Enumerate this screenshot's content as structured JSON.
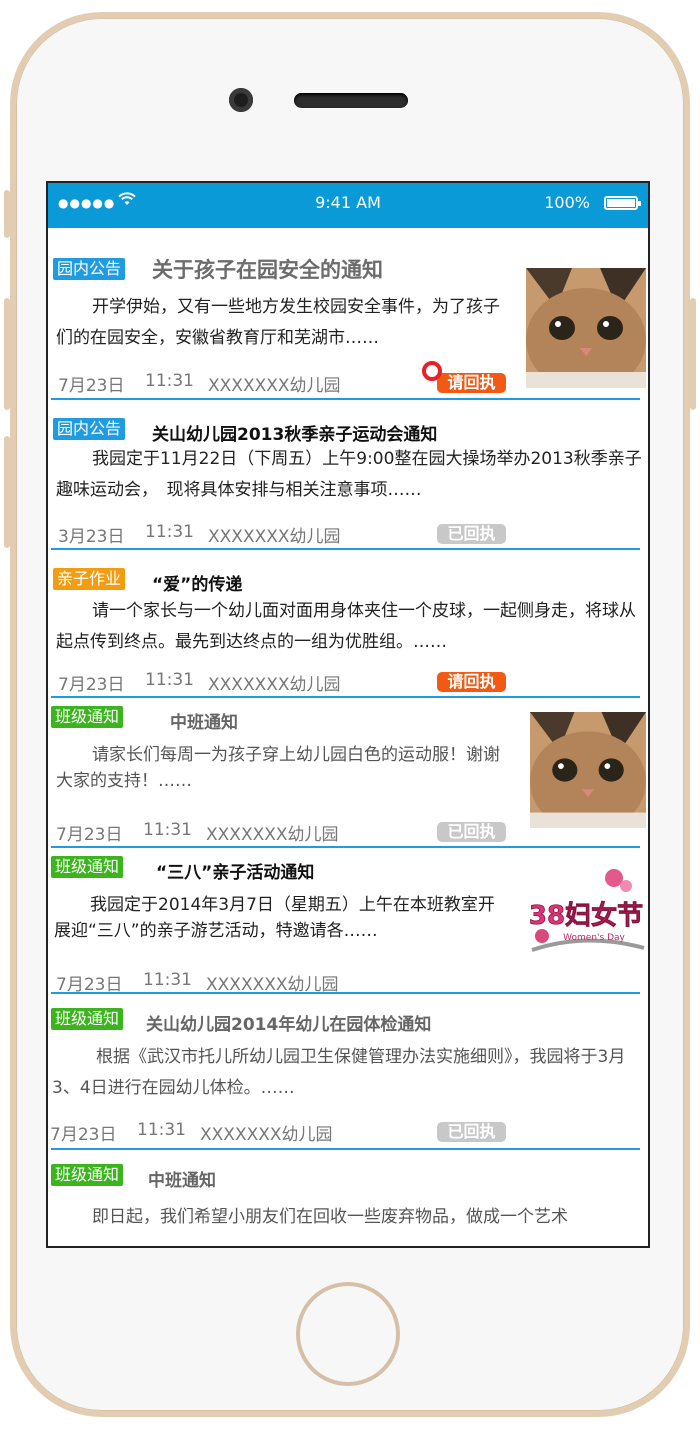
{
  "status_bar": {
    "signal": "●●●●●",
    "time": "9:41 AM",
    "battery": "100%"
  },
  "notices": [
    {
      "tag": "园内公告",
      "title": "关于孩子在园安全的通知",
      "body": "开学伊始，又有一些地方发生校园安全事件，为了孩子们的在园安全，安徽省教育厅和芜湖市……",
      "date": "7月23日",
      "time": "11:31",
      "school": "XXXXXXX幼儿园",
      "receipt": "请回执",
      "thumbnail": "cat-photo"
    },
    {
      "tag": "园内公告",
      "title": "关山幼儿园2013秋季亲子运动会通知",
      "body": "我园定于11月22日（下周五）上午9:00整在园大操场举办2013秋季亲子趣味运动会，　现将具体安排与相关注意事项……",
      "date": "3月23日",
      "time": "11:31",
      "school": "XXXXXXX幼儿园",
      "receipt": "已回执"
    },
    {
      "tag": "亲子作业",
      "title": "“爱”的传递",
      "body": "请一个家长与一个幼儿面对面用身体夹住一个皮球，一起侧身走，将球从起点传到终点。最先到达终点的一组为优胜组。……",
      "date": "7月23日",
      "time": "11:31",
      "school": "XXXXXXX幼儿园",
      "receipt": "请回执"
    },
    {
      "tag": "班级通知",
      "title": "中班通知",
      "body": "请家长们每周一为孩子穿上幼儿园白色的运动服！谢谢大家的支持！……",
      "date": "7月23日",
      "time": "11:31",
      "school": "XXXXXXX幼儿园",
      "receipt": "已回执",
      "thumbnail": "cat-photo"
    },
    {
      "tag": "班级通知",
      "title": "“三八”亲子活动通知",
      "body": "我园定于2014年3月7日（星期五）上午在本班教室开展迎“三八”的亲子游艺活动，特邀请各……",
      "date": "7月23日",
      "time": "11:31",
      "school": "XXXXXXX幼儿园",
      "thumbnail": "womens-day-graphic",
      "thumbnail_text": "38妇女节",
      "thumbnail_subtext": "Women's Day"
    },
    {
      "tag": "班级通知",
      "title": "关山幼儿园2014年幼儿在园体检通知",
      "body": "根据《武汉市托儿所幼儿园卫生保健管理办法实施细则》，我园将于3月3、4日进行在园幼儿体检。……",
      "date": "7月23日",
      "time": "11:31",
      "school": "XXXXXXX幼儿园",
      "receipt": "已回执"
    },
    {
      "tag": "班级通知",
      "title": "中班通知",
      "body": "即日起，我们希望小朋友们在回收一些废弃物品，做成一个艺术"
    }
  ],
  "colors": {
    "accent": "#0a9ad8",
    "tag_blue": "#1e9be1",
    "tag_orange": "#f39c12",
    "tag_green": "#3cb41e",
    "receipt_pending": "#f05a14",
    "receipt_done": "#c8c8c8"
  }
}
